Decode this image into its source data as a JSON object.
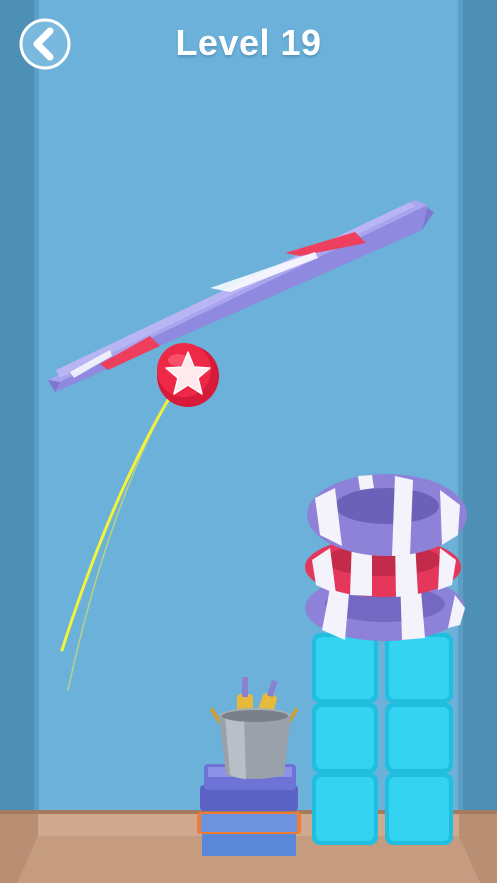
{
  "header": {
    "back_icon": "chevron-left-icon",
    "level_label": "Level 19"
  },
  "colors": {
    "sky": "#6bb1d9",
    "side_wall": "#4d8db3",
    "floor": "#c49b80",
    "plank": "#8d88de",
    "plank_stripe": "#ee3f5e",
    "ball": "#e41c3d",
    "trajectory": "#f2f23a",
    "ring_purple": "#8d80d6",
    "ring_red": "#e93d5a",
    "cube": "#2ed0ef"
  },
  "objects": {
    "plank": "plank",
    "ball": "star-ball",
    "trajectory": "trajectory-trail",
    "rings": [
      "ring-purple-top",
      "ring-red-middle",
      "ring-purple-bottom"
    ],
    "cube_tower_rows": 3,
    "cube_tower_cols": 2,
    "bucket": "ice-bucket",
    "bottles": 2,
    "box_stack": "box-stack"
  }
}
